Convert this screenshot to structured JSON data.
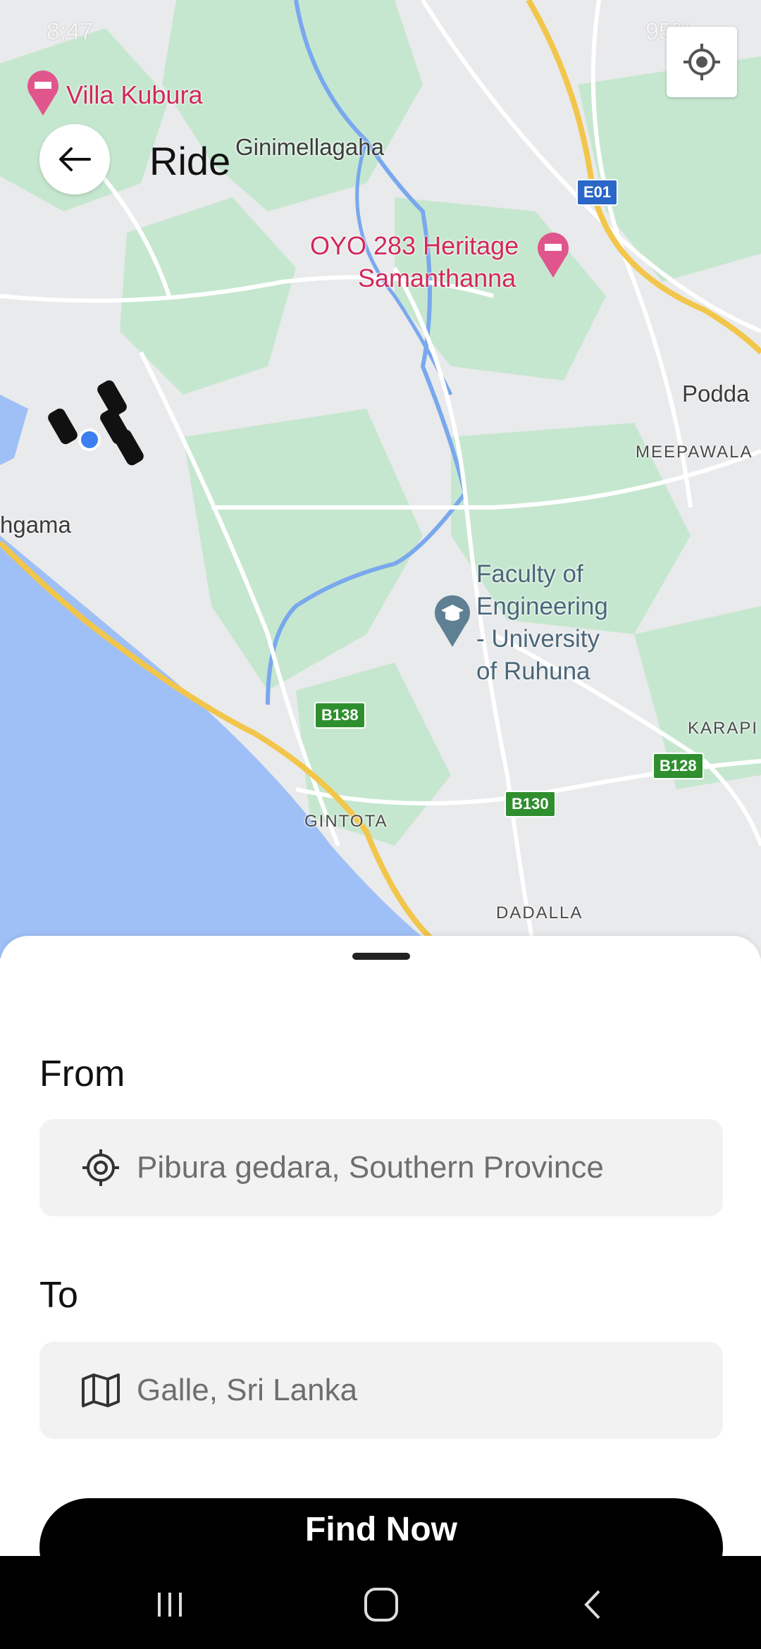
{
  "status_bar": {
    "time": "8:47",
    "battery": "95%"
  },
  "map": {
    "places": {
      "villa": "Villa Kubura",
      "ginimellagaha": "Ginimellagaha",
      "oyo_line1": "OYO 283 Heritage",
      "oyo_line2": "Samanthanna",
      "podda": "Podda",
      "meepawala": "MEEPAWALA",
      "hgama": "hgama",
      "faculty_1": "Faculty of",
      "faculty_2": "Engineering",
      "faculty_3": "- University",
      "faculty_4": "of Ruhuna",
      "karapi": "KARAPI",
      "gintota": "GINTOTA",
      "dadalla": "DADALLA"
    },
    "shields": {
      "e01": "E01",
      "b138": "B138",
      "b128": "B128",
      "b130": "B130"
    },
    "colors": {
      "water": "#9fc0f7",
      "park": "#c6e7cf",
      "highway": "#f2c64a",
      "land": "#e9eaec"
    }
  },
  "header": {
    "title": "Ride"
  },
  "sheet": {
    "from_label": "From",
    "from_value": "Pibura gedara, Southern Province",
    "to_label": "To",
    "to_value": "Galle, Sri Lanka",
    "button_label": "Find Now"
  }
}
